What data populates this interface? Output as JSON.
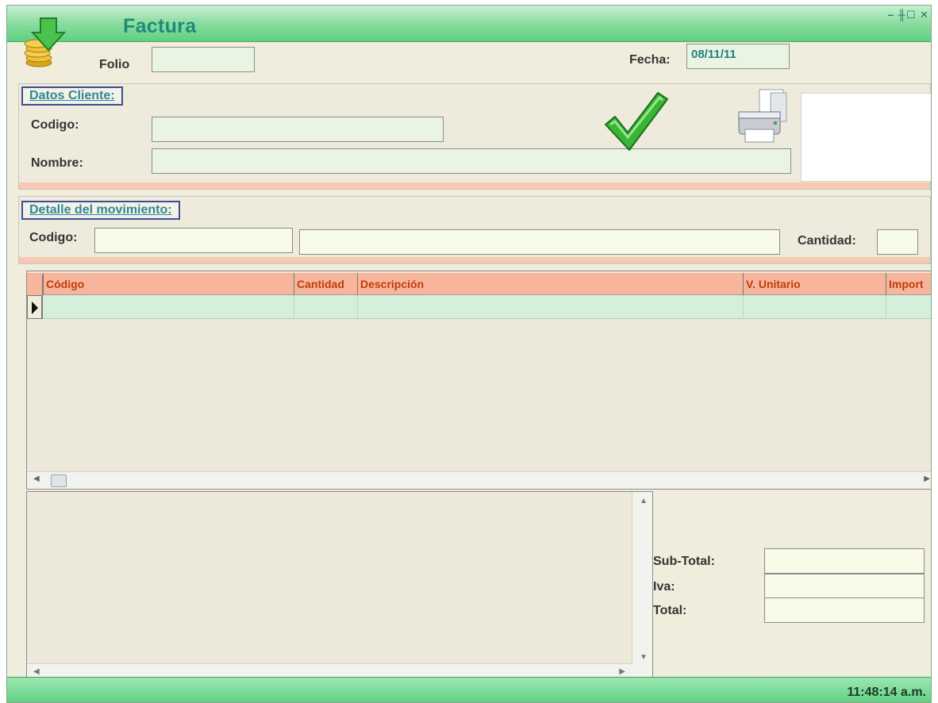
{
  "window": {
    "title": "Factura",
    "controls": "– ╫☐ ✕"
  },
  "header": {
    "folio_label": "Folio",
    "folio_value": "",
    "fecha_label": "Fecha:",
    "fecha_value": "08/11/11"
  },
  "cliente": {
    "legend": "Datos Cliente:",
    "codigo_label": "Codigo:",
    "codigo_value": "",
    "nombre_label": "Nombre:",
    "nombre_value": ""
  },
  "movimiento": {
    "legend": "Detalle del movimiento:",
    "codigo_label": "Codigo:",
    "codigo_value": "",
    "descripcion_value": "",
    "cantidad_label": "Cantidad:",
    "cantidad_value": ""
  },
  "grid": {
    "columns": [
      "Código",
      "Cantidad",
      "Descripción",
      "V. Unitario",
      "Import"
    ],
    "rows": [
      [
        "",
        "",
        "",
        "",
        ""
      ]
    ]
  },
  "totals": {
    "subtotal_label": "Sub-Total:",
    "subtotal_value": "",
    "iva_label": "Iva:",
    "iva_value": "",
    "total_label": "Total:",
    "total_value": ""
  },
  "status": {
    "clock": "11:48:14 a.m."
  },
  "icons": {
    "app": "coins-download-icon",
    "accept": "checkmark-icon",
    "print": "printer-icon"
  },
  "colors": {
    "titlebar": "#5fcf80",
    "title_text": "#1f8a78",
    "grid_header": "#f7b59c",
    "grid_header_text": "#c13c0c",
    "field_bg": "#e9f5e2",
    "legend_border": "#3b4e96"
  }
}
